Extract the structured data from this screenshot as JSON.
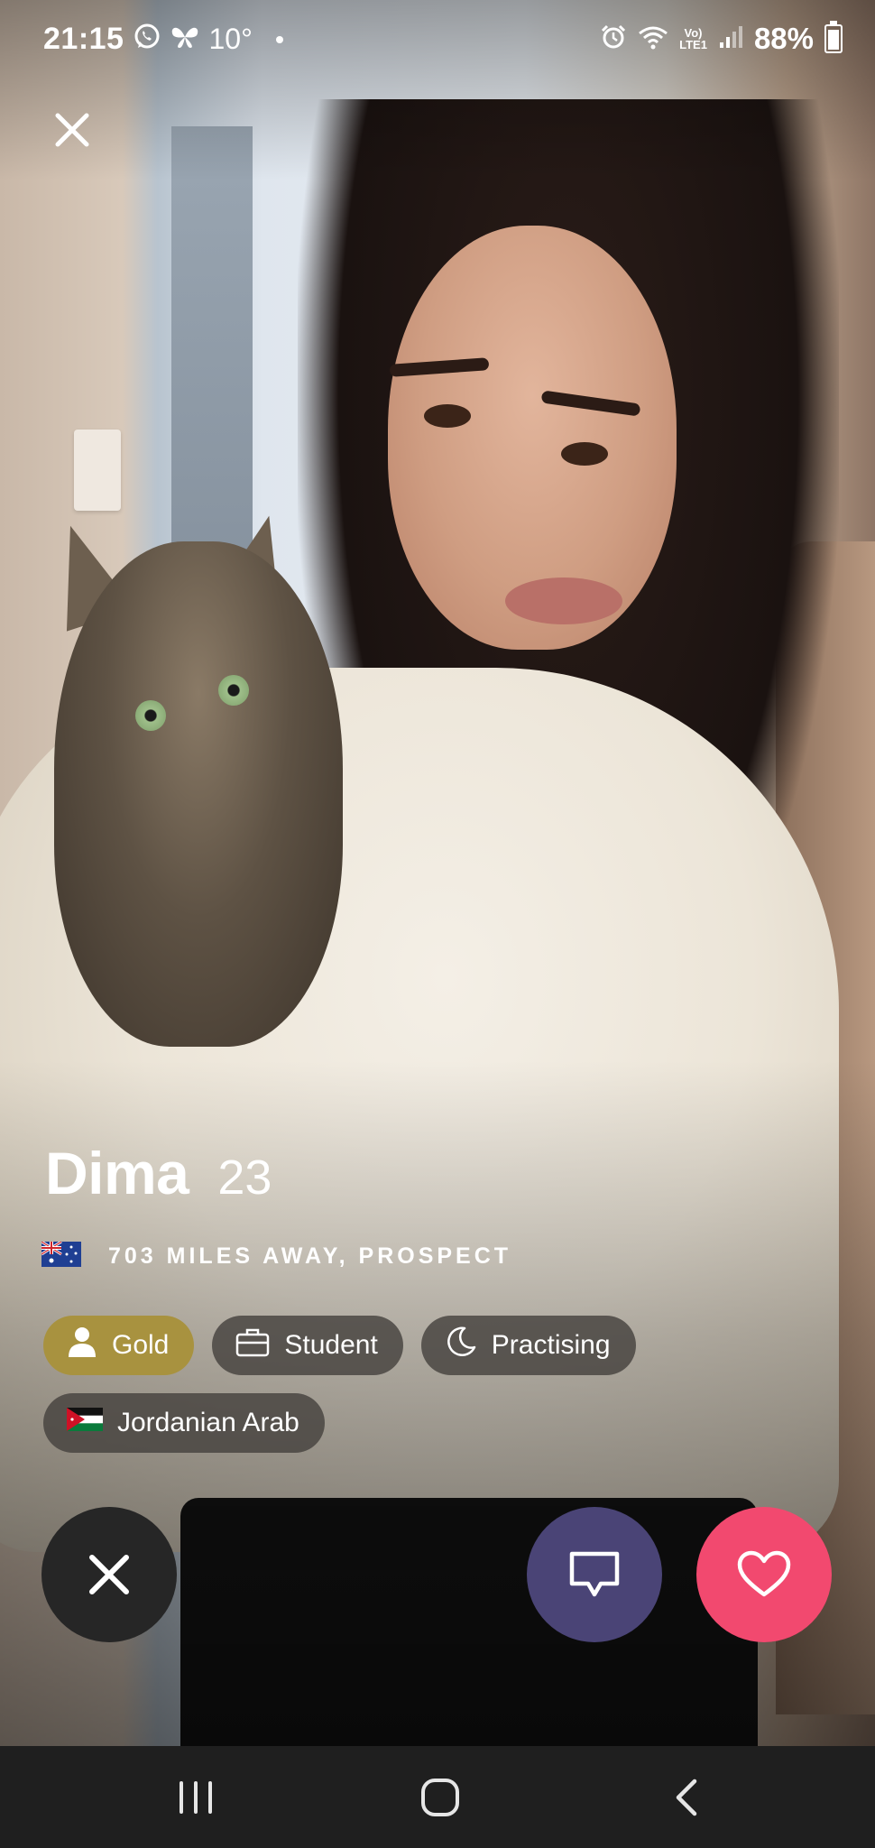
{
  "status_bar": {
    "time": "21:15",
    "weather_temp": "10°",
    "battery": "88%",
    "network_top": "Vo)",
    "network_bottom": "LTE1"
  },
  "profile": {
    "name": "Dima",
    "age": "23",
    "location": "703 MILES AWAY, PROSPECT",
    "location_flag_icon": "australia-flag-icon"
  },
  "tags": [
    {
      "label": "Gold",
      "icon": "person-icon"
    },
    {
      "label": "Student",
      "icon": "briefcase-icon"
    },
    {
      "label": "Practising",
      "icon": "moon-icon"
    },
    {
      "label": "Jordanian Arab",
      "icon": "jordan-flag-icon"
    }
  ],
  "colors": {
    "gold_tag": "#a8923f",
    "chat_button": "#4a4476",
    "like_button": "#f2496f",
    "pass_button": "#262626"
  }
}
